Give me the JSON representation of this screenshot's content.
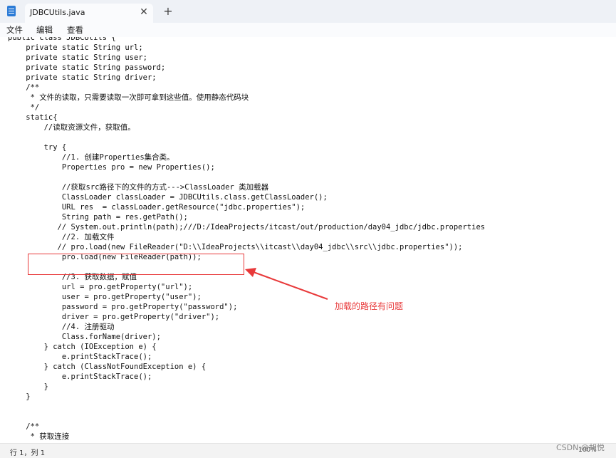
{
  "window": {
    "tab_title": "JDBCUtils.java",
    "close_glyph": "✕",
    "new_tab_glyph": "+",
    "icon": "notepad-icon"
  },
  "menu": [
    "文件",
    "编辑",
    "查看"
  ],
  "code_lines": [
    "public class JDBCUtils {",
    "    private static String url;",
    "    private static String user;",
    "    private static String password;",
    "    private static String driver;",
    "    /**",
    "     * 文件的读取，只需要读取一次即可拿到这些值。使用静态代码块",
    "     */",
    "    static{",
    "        //读取资源文件，获取值。",
    "",
    "        try {",
    "            //1. 创建Properties集合类。",
    "            Properties pro = new Properties();",
    "",
    "            //获取src路径下的文件的方式--->ClassLoader 类加载器",
    "            ClassLoader classLoader = JDBCUtils.class.getClassLoader();",
    "            URL res  = classLoader.getResource(\"jdbc.properties\");",
    "            String path = res.getPath();",
    "           // System.out.println(path);///D:/IdeaProjects/itcast/out/production/day04_jdbc/jdbc.properties",
    "            //2. 加载文件",
    "           // pro.load(new FileReader(\"D:\\\\IdeaProjects\\\\itcast\\\\day04_jdbc\\\\src\\\\jdbc.properties\"));",
    "            pro.load(new FileReader(path));",
    "",
    "            //3. 获取数据，赋值",
    "            url = pro.getProperty(\"url\");",
    "            user = pro.getProperty(\"user\");",
    "            password = pro.getProperty(\"password\");",
    "            driver = pro.getProperty(\"driver\");",
    "            //4. 注册驱动",
    "            Class.forName(driver);",
    "        } catch (IOException e) {",
    "            e.printStackTrace();",
    "        } catch (ClassNotFoundException e) {",
    "            e.printStackTrace();",
    "        }",
    "    }",
    "",
    "",
    "    /**",
    "     * 获取连接"
  ],
  "annotation": {
    "text": "加载的路径有问题",
    "color": "#e8393a"
  },
  "status": {
    "position": "行 1，列 1",
    "zoom": "100%"
  },
  "watermark": "CSDN @胡悦"
}
